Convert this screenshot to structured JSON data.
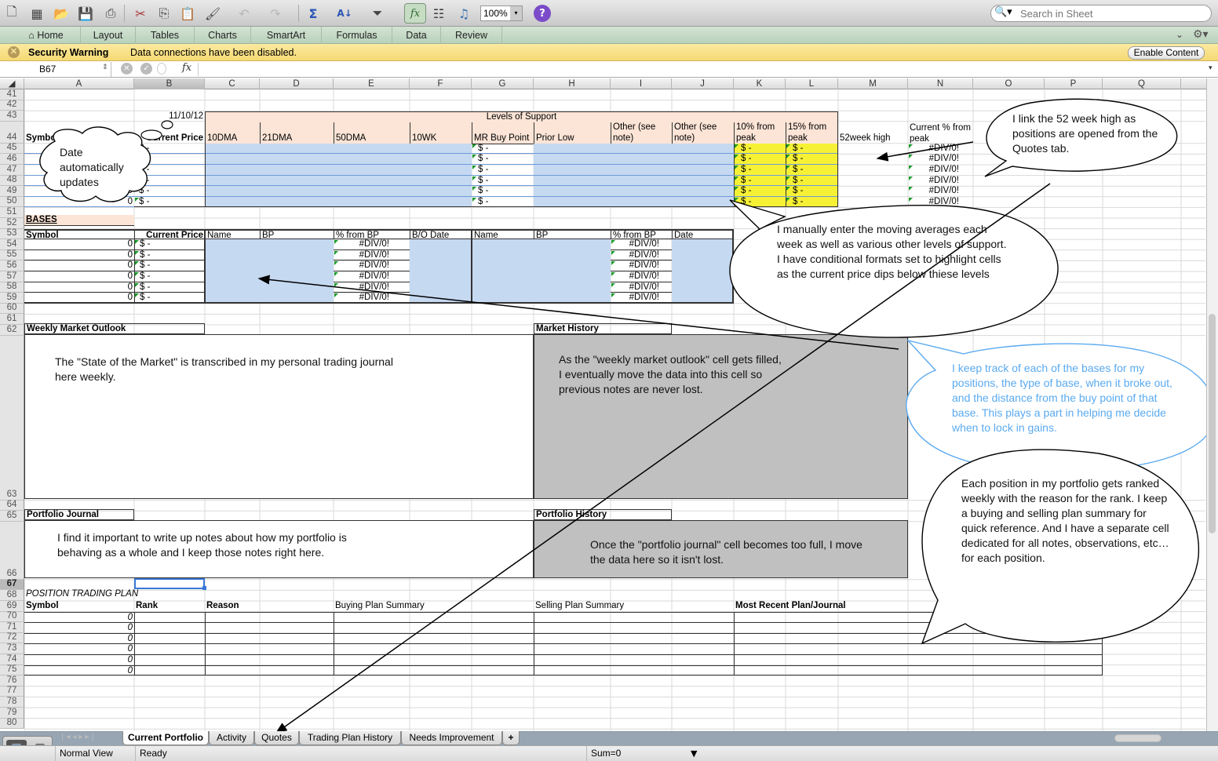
{
  "toolbar": {
    "icons": [
      "new-icon",
      "gallery-icon",
      "open-icon",
      "save-icon",
      "print-icon",
      "cut-icon",
      "copy-icon",
      "paste-icon",
      "format-painter-icon",
      "undo-icon",
      "redo-icon",
      "autosum-icon",
      "sort-icon",
      "filter-icon",
      "formula-builder-icon",
      "show-hide-icon",
      "media-browser-icon",
      "help-icon"
    ],
    "zoom": "100%",
    "search_placeholder": "Search in Sheet"
  },
  "ribbon": {
    "tabs": [
      "Home",
      "Layout",
      "Tables",
      "Charts",
      "SmartArt",
      "Formulas",
      "Data",
      "Review"
    ]
  },
  "security_bar": {
    "title": "Security Warning",
    "message": "Data connections have been disabled.",
    "button": "Enable Content"
  },
  "formula_bar": {
    "name_box": "B67",
    "fx": "fx",
    "value": ""
  },
  "columns": [
    "A",
    "B",
    "C",
    "D",
    "E",
    "F",
    "G",
    "H",
    "I",
    "J",
    "K",
    "L",
    "M",
    "N",
    "O",
    "P",
    "Q"
  ],
  "selected_column": "B",
  "rows": [
    "41",
    "42",
    "43",
    "44",
    "45",
    "46",
    "47",
    "48",
    "49",
    "50",
    "51",
    "52",
    "53",
    "54",
    "55",
    "56",
    "57",
    "58",
    "59",
    "60",
    "61",
    "62",
    "63",
    "64",
    "65",
    "66",
    "67",
    "68",
    "69",
    "70",
    "71",
    "72",
    "73",
    "74",
    "75",
    "76",
    "77",
    "78",
    "79",
    "80"
  ],
  "selected_row": "67",
  "support_table": {
    "date": "11/10/12",
    "group_header": "Levels of Support",
    "headers": {
      "symbol": "Symbol",
      "current_price": "Current Price",
      "c": "10DMA",
      "d": "21DMA",
      "e": "50DMA",
      "f": "10WK",
      "g": "MR Buy Point",
      "h": "Prior Low",
      "i": "Other (see note)",
      "j": "Other (see note)",
      "k": "10% from peak",
      "l": "15% from peak",
      "m": "52week high",
      "n": "Current % from peak"
    },
    "rows": [
      {
        "symbol": "0",
        "price": "$ -",
        "mr_buy": "$ -",
        "k": "$ -",
        "l": "$ -",
        "pct": "#DIV/0!"
      },
      {
        "symbol": "0",
        "price": "$ -",
        "mr_buy": "$ -",
        "k": "$ -",
        "l": "$ -",
        "pct": "#DIV/0!"
      },
      {
        "symbol": "0",
        "price": "$ -",
        "mr_buy": "$ -",
        "k": "$ -",
        "l": "$ -",
        "pct": "#DIV/0!"
      },
      {
        "symbol": "0",
        "price": "$ -",
        "mr_buy": "$ -",
        "k": "$ -",
        "l": "$ -",
        "pct": "#DIV/0!"
      },
      {
        "symbol": "0",
        "price": "$ -",
        "mr_buy": "$ -",
        "k": "$ -",
        "l": "$ -",
        "pct": "#DIV/0!"
      },
      {
        "symbol": "0",
        "price": "$ -",
        "mr_buy": "$ -",
        "k": "$ -",
        "l": "$ -",
        "pct": "#DIV/0!"
      }
    ]
  },
  "bases_table": {
    "title": "BASES",
    "headers": [
      "Symbol",
      "Current Price",
      "Name",
      "BP",
      "% from BP",
      "B/O Date",
      "Name",
      "BP",
      "% from BP",
      "Date"
    ],
    "rows": [
      {
        "symbol": "0",
        "price": "$ -",
        "pct1": "#DIV/0!",
        "pct2": "#DIV/0!"
      },
      {
        "symbol": "0",
        "price": "$ -",
        "pct1": "#DIV/0!",
        "pct2": "#DIV/0!"
      },
      {
        "symbol": "0",
        "price": "$ -",
        "pct1": "#DIV/0!",
        "pct2": "#DIV/0!"
      },
      {
        "symbol": "0",
        "price": "$ -",
        "pct1": "#DIV/0!",
        "pct2": "#DIV/0!"
      },
      {
        "symbol": "0",
        "price": "$ -",
        "pct1": "#DIV/0!",
        "pct2": "#DIV/0!"
      },
      {
        "symbol": "0",
        "price": "$ -",
        "pct1": "#DIV/0!",
        "pct2": "#DIV/0!"
      }
    ]
  },
  "sections": {
    "weekly_outlook_label": "Weekly Market Outlook",
    "weekly_outlook_text": "The \"State of the Market\" is transcribed in my personal trading journal here weekly.",
    "market_history_label": "Market History",
    "market_history_text": "As the \"weekly market outlook\" cell gets filled, I eventually move the data into this cell so previous notes are never lost.",
    "portfolio_journal_label": "Portfolio Journal",
    "portfolio_journal_text": "I find it important to write up notes about how my portfolio is behaving as a whole and I keep those notes right here.",
    "portfolio_history_label": "Portfolio History",
    "portfolio_history_text": "Once the \"portfolio journal\" cell becomes too full, I move the data here so it isn't lost."
  },
  "trading_plan": {
    "title": "POSITION TRADING PLAN",
    "headers": [
      "Symbol",
      "Rank",
      "Reason",
      "Buying Plan Summary",
      "Selling Plan Summary",
      "Most Recent Plan/Journal"
    ],
    "symbols": [
      "0",
      "0",
      "0",
      "0",
      "0",
      "0"
    ]
  },
  "callouts": {
    "date_cloud": "Date automatically updates",
    "link_52wk": "I link the 52 week high as positions are opened from the Quotes tab.",
    "moving_avgs": "I manually enter the moving averages each week as well as various other levels of support. I have conditional formats set to highlight cells as the current price dips below thiese levels",
    "bases_note": "I keep track of each of the bases for my positions, the type of base, when it broke out, and the distance from the buy point of that base. This plays a part in helping me decide when to lock in gains.",
    "ranking_note": "Each position in my portfolio gets ranked weekly with the reason for the rank.  I keep a buying and selling plan summary for quick reference. And I have a separate cell dedicated for all notes, observations, etc…for each position."
  },
  "colors": {
    "peach": "#fce4d6",
    "input_blue": "#c5d9f1",
    "highlight_yellow": "#f7f135",
    "history_gray": "#c0c0c0",
    "callout_blue": "#5aaaf0"
  },
  "sheet_tabs": [
    "Current Portfolio",
    "Activity",
    "Quotes",
    "Trading Plan History",
    "Needs Improvement"
  ],
  "active_sheet": "Current Portfolio",
  "status_bar": {
    "view": "Normal View",
    "status": "Ready",
    "sum": "Sum=0"
  }
}
